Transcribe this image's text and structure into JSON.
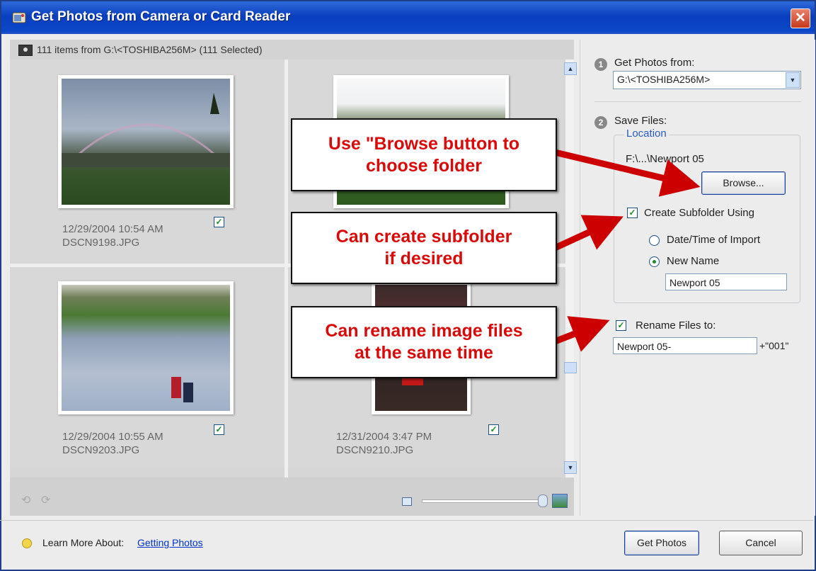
{
  "window": {
    "title": "Get Photos from Camera or Card Reader",
    "close_glyph": "✕"
  },
  "status": {
    "text": "111 items from G:\\<TOSHIBA256M> (111 Selected)"
  },
  "photos": [
    {
      "date": "12/29/2004 10:54 AM",
      "file": "DSCN9198.JPG",
      "checked": true
    },
    {
      "date": "",
      "file": "",
      "checked": true
    },
    {
      "date": "12/29/2004 10:55 AM",
      "file": "DSCN9203.JPG",
      "checked": true
    },
    {
      "date": "12/31/2004 3:47 PM",
      "file": "DSCN9210.JPG",
      "checked": true
    }
  ],
  "right": {
    "step1": {
      "num": "1",
      "label": "Get Photos from:",
      "source": "G:\\<TOSHIBA256M>"
    },
    "step2": {
      "num": "2",
      "label": "Save Files:"
    },
    "location": {
      "legend": "Location",
      "path": "F:\\...\\Newport 05",
      "browse": "Browse...",
      "subfolder_label": "Create Subfolder Using",
      "subfolder_checked": true,
      "radio_date": "Date/Time of Import",
      "radio_new": "New Name",
      "selected": "New Name",
      "new_name_value": "Newport 05"
    },
    "rename": {
      "label": "Rename Files to:",
      "checked": true,
      "value": "Newport 05-",
      "suffix": "+\"001\""
    }
  },
  "footer": {
    "learn_label": "Learn More About:",
    "learn_link": "Getting Photos",
    "get_photos": "Get Photos",
    "cancel": "Cancel"
  },
  "callouts": {
    "browse": [
      "Use \"Browse button to",
      "choose folder"
    ],
    "subfolder": [
      "Can create subfolder",
      "if desired"
    ],
    "rename": [
      "Can rename image files",
      "at the same time"
    ]
  },
  "colors": {
    "callout_text": "#d80a0a",
    "arrow": "#cc0000",
    "title_bar": "#0a47c8",
    "link": "#0033cc"
  },
  "icons": {
    "check": "✓",
    "scroll_up": "▲",
    "scroll_down": "▼",
    "dropdown": "▼"
  }
}
